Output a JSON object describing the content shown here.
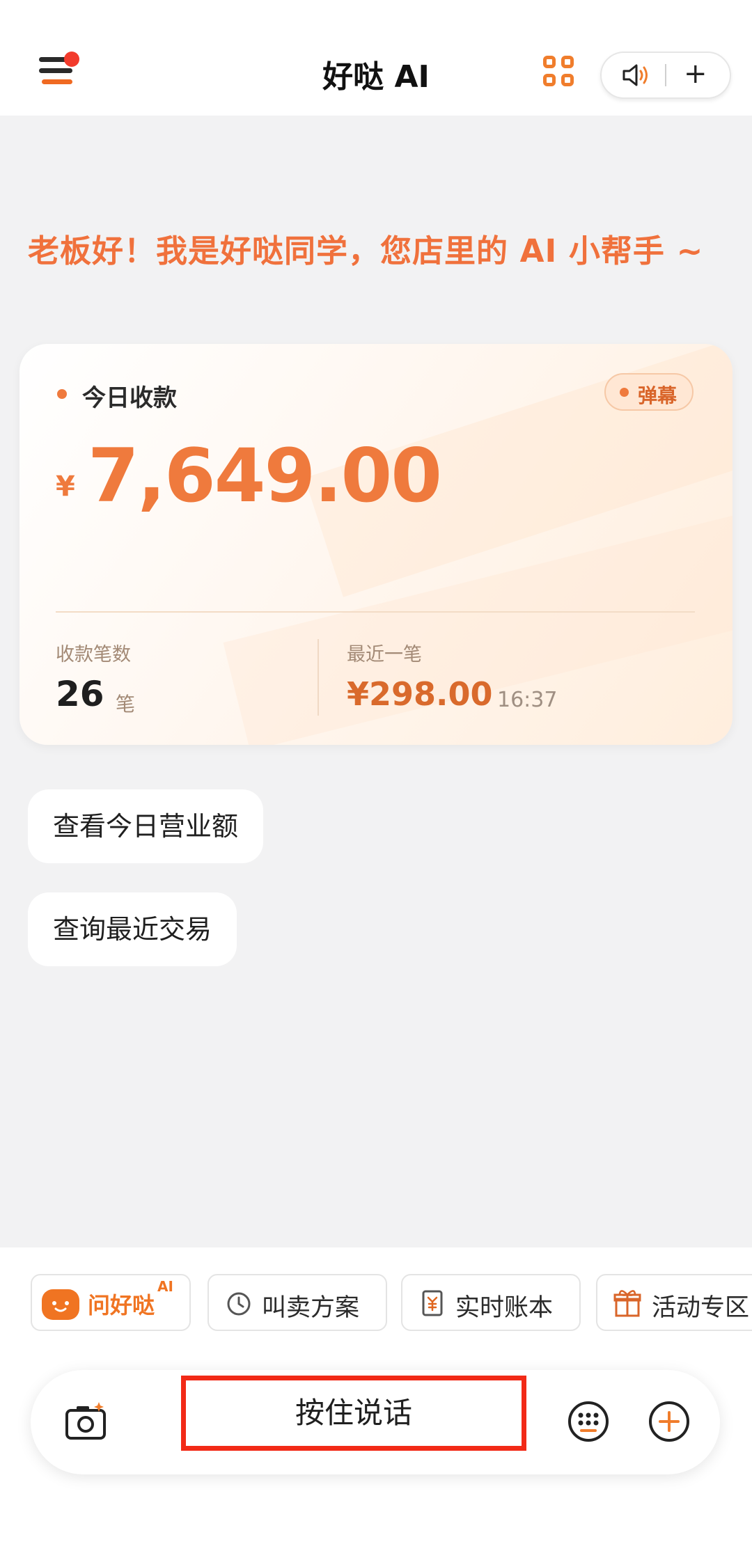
{
  "header": {
    "title": "好哒 AI",
    "plus_symbol": "+"
  },
  "greeting": "老板好！我是好哒同学，您店里的 AI 小帮手 ~",
  "card": {
    "title": "今日收款",
    "danmu_button": "弹幕",
    "currency": "¥",
    "amount": "7,649.00",
    "count_label": "收款笔数",
    "count_value": "26",
    "count_unit": "笔",
    "last_label": "最近一笔",
    "last_amount": "¥298.00",
    "last_time": "16:37"
  },
  "suggestions": [
    "查看今日营业额",
    "查询最近交易"
  ],
  "quick_actions": {
    "wen": {
      "label": "问好哒",
      "badge": "AI"
    },
    "items": [
      {
        "label": "叫卖方案",
        "icon": "clock-icon"
      },
      {
        "label": "实时账本",
        "icon": "ledger-icon"
      },
      {
        "label": "活动专区",
        "icon": "gift-icon"
      }
    ]
  },
  "input_bar": {
    "talk_label": "按住说话"
  },
  "colors": {
    "accent": "#ef7a3d",
    "highlight_border": "#f22a17"
  }
}
